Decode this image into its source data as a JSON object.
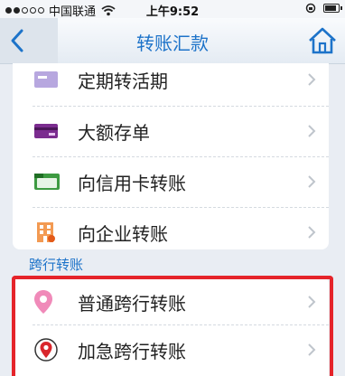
{
  "status_bar": {
    "carrier": "中国联通",
    "time": "上午9:52"
  },
  "nav": {
    "title": "转账汇款",
    "back_icon": "chevron-left-icon",
    "home_icon": "home-icon"
  },
  "menu": {
    "items": [
      {
        "label": "定期转活期",
        "icon": "fixed-to-current-icon"
      },
      {
        "label": "大额存单",
        "icon": "certificate-card-icon"
      },
      {
        "label": "向信用卡转账",
        "icon": "credit-card-icon"
      },
      {
        "label": "向企业转账",
        "icon": "enterprise-building-icon"
      }
    ]
  },
  "cross_bank": {
    "section_title": "跨行转账",
    "items": [
      {
        "label": "普通跨行转账",
        "icon": "location-pin-icon"
      },
      {
        "label": "加急跨行转账",
        "icon": "urgent-location-icon"
      }
    ]
  },
  "colors": {
    "accent": "#1d73c9",
    "highlight": "#e5242a",
    "background": "#e9edf3"
  }
}
